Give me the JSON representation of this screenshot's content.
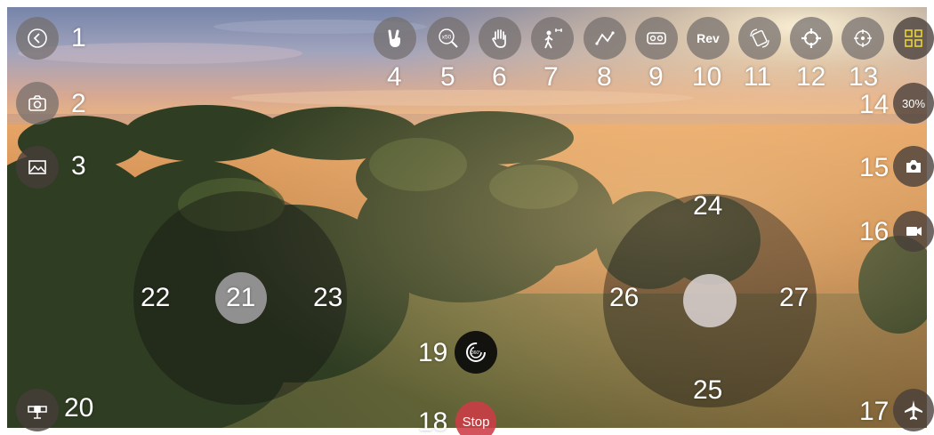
{
  "labels": {
    "n1": "1",
    "n2": "2",
    "n3": "3",
    "n4": "4",
    "n5": "5",
    "n6": "6",
    "n7": "7",
    "n8": "8",
    "n9": "9",
    "n10": "10",
    "n11": "11",
    "n12": "12",
    "n13": "13",
    "n14": "14",
    "n15": "15",
    "n16": "16",
    "n17": "17",
    "n18": "18",
    "n19": "19",
    "n20": "20",
    "n21": "21",
    "n22": "22",
    "n23": "23",
    "n24": "24",
    "n25": "25",
    "n26": "26",
    "n27": "27"
  },
  "toolbar": {
    "rev_label": "Rev",
    "zoom_label": "x50"
  },
  "speed": {
    "label": "30%"
  },
  "stop": {
    "label": "Stop"
  },
  "panorama": {
    "label": "360°"
  },
  "icons": {
    "back": "back-chevron-icon",
    "photo": "camera-outline-icon",
    "gallery": "image-gallery-icon",
    "gesture": "peace-gesture-icon",
    "zoom": "zoom-magnifier-icon",
    "hand": "palm-hand-icon",
    "follow": "follow-me-icon",
    "route": "waypoint-route-icon",
    "vr": "vr-headset-icon",
    "rotate": "screen-rotate-icon",
    "headless": "headless-mode-icon",
    "gyro": "gyro-calibrate-icon",
    "grid": "grid-icon",
    "camera": "camera-icon",
    "video": "video-icon",
    "plane": "airplane-icon",
    "satellite": "satellite-icon"
  },
  "colors": {
    "button_dark": "#463e3a",
    "stop_red": "#cd3c46",
    "grid_yellow": "#e8d23a"
  }
}
